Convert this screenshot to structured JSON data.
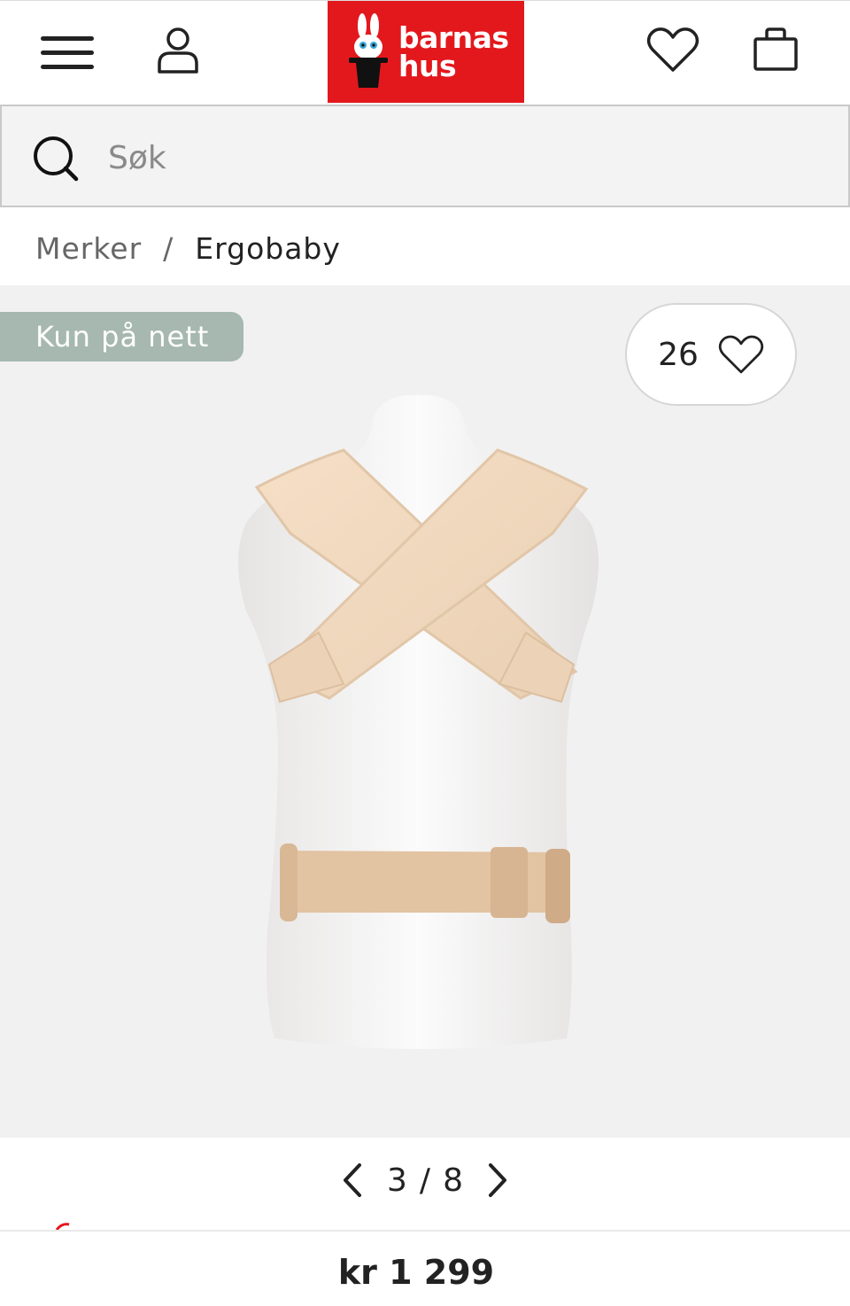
{
  "header": {
    "logo_line1": "barnas",
    "logo_line2": "hus",
    "icons": {
      "menu": "hamburger-menu-icon",
      "user": "user-icon",
      "favorites": "heart-icon",
      "cart": "shopping-bag-icon"
    },
    "brand_color": "#e3181d"
  },
  "search": {
    "placeholder": "Søk",
    "value": ""
  },
  "breadcrumb": {
    "items": [
      "Merker",
      "Ergobaby"
    ],
    "separator": "/"
  },
  "gallery": {
    "badge": "Kun på nett",
    "like_count": "26",
    "current": "3",
    "separator": "/",
    "total": "8",
    "background": "#f2f1f1",
    "badge_color": "#a6b8b0"
  },
  "product": {
    "price": "kr 1 299"
  }
}
